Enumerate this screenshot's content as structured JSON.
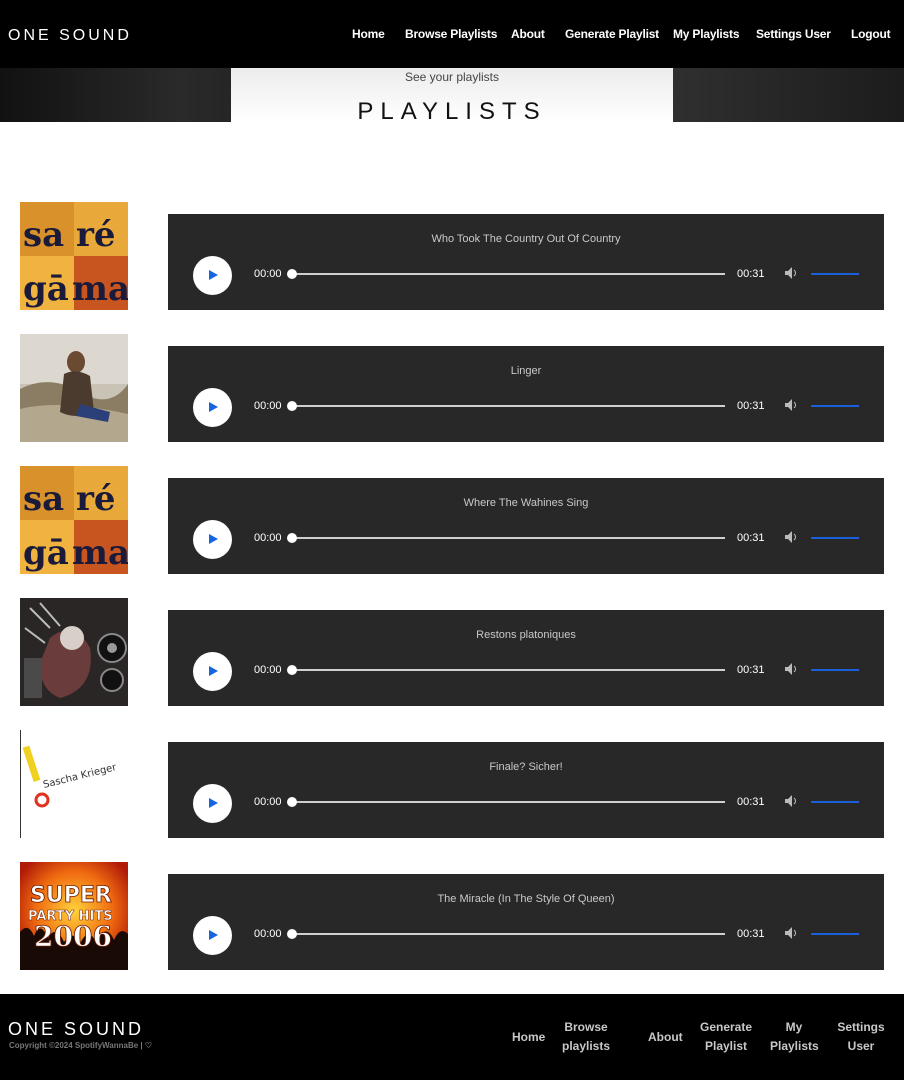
{
  "header": {
    "logo": "ONE SOUND",
    "nav": [
      "Home",
      "Browse Playlists",
      "About",
      "Generate Playlist",
      "My Playlists",
      "Settings User",
      "Logout"
    ]
  },
  "hero": {
    "subtitle": "See your playlists",
    "title": "PLAYLISTS"
  },
  "tracks": [
    {
      "title": "Who Took The Country Out Of Country",
      "current": "00:00",
      "duration": "00:31",
      "cover": "saregama-cover"
    },
    {
      "title": "Linger",
      "current": "00:00",
      "duration": "00:31",
      "cover": "photo-cover"
    },
    {
      "title": "Where The Wahines Sing",
      "current": "00:00",
      "duration": "00:31",
      "cover": "saregama-cover"
    },
    {
      "title": "Restons platoniques",
      "current": "00:00",
      "duration": "00:31",
      "cover": "collage-cover"
    },
    {
      "title": "Finale? Sicher!",
      "current": "00:00",
      "duration": "00:31",
      "cover": "sascha-krieger-cover"
    },
    {
      "title": "The Miracle (In The Style Of Queen)",
      "current": "00:00",
      "duration": "00:31",
      "cover": "super-party-hits-cover"
    }
  ],
  "covers": {
    "saregama": {
      "l1a": "sa",
      "l1b": "ré",
      "l2a": "gā",
      "l2b": "ma"
    },
    "sascha": "Sascha Krieger",
    "party": {
      "l1": "SUPER",
      "l2": "PARTY HITS",
      "l3": "2006"
    }
  },
  "footer": {
    "logo": "ONE SOUND",
    "copyright": "Copyright ©2024 SpotifyWannaBe | ♡",
    "nav": [
      "Home",
      "Browse playlists",
      "About",
      "Generate Playlist",
      "My Playlists",
      "Settings User"
    ]
  },
  "colors": {
    "accent": "#1565e0",
    "player_bg": "#282828",
    "header_bg": "#000000"
  }
}
